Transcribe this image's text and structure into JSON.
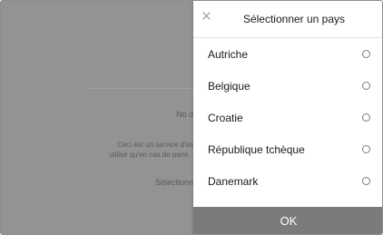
{
  "background": {
    "partial_heading": "No d",
    "description_line1": "Ceci est un service d'ass",
    "description_line2": "utilisé qu'en cas de pann",
    "select_prompt": "Sélectionn"
  },
  "sheet": {
    "title": "Sélectionner un pays",
    "close_icon": "close-icon",
    "countries": [
      {
        "label": "Autriche",
        "selected": false
      },
      {
        "label": "Belgique",
        "selected": false
      },
      {
        "label": "Croatie",
        "selected": false
      },
      {
        "label": "République tchèque",
        "selected": false
      },
      {
        "label": "Danemark",
        "selected": false
      }
    ],
    "ok_label": "OK"
  },
  "colors": {
    "overlay": "#939393",
    "sheet_background": "#ffffff",
    "ok_button": "#7b7b7b"
  }
}
